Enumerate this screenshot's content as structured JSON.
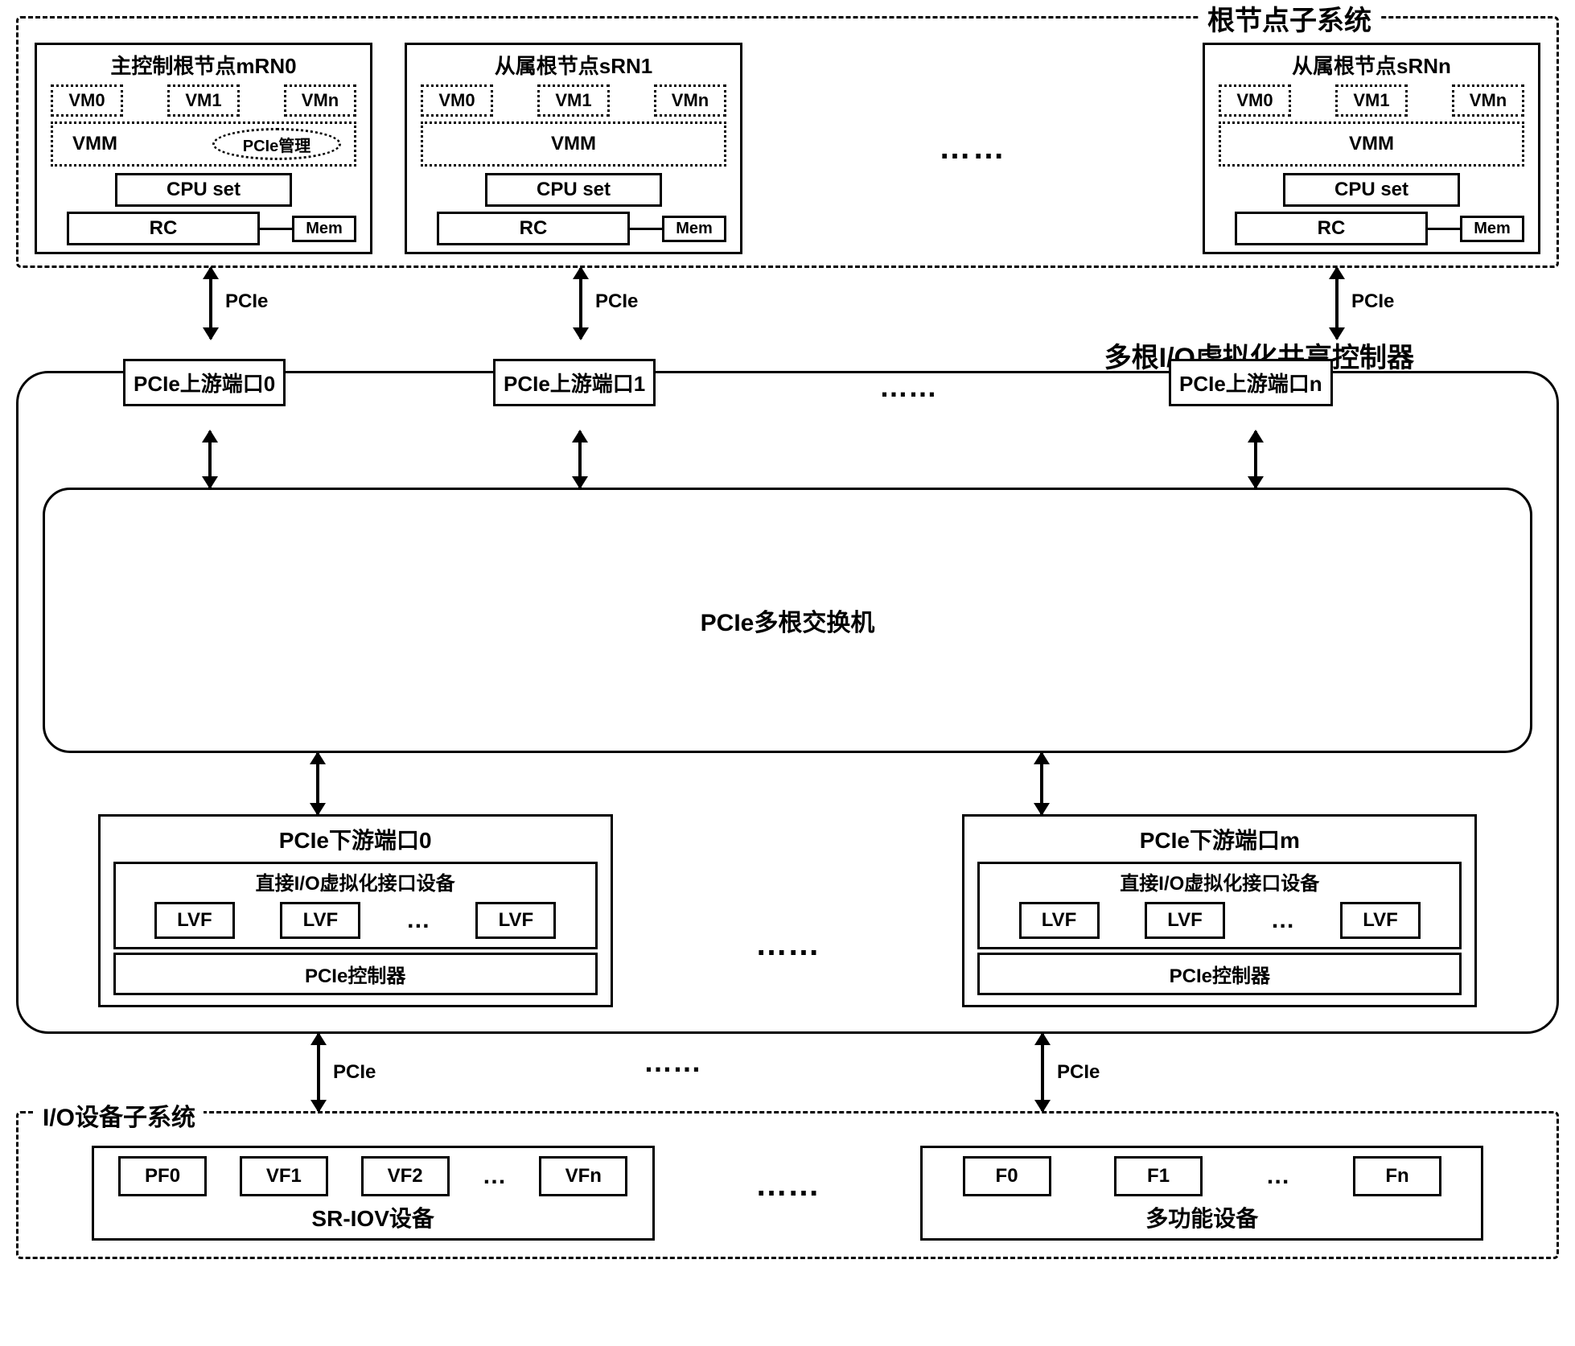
{
  "root_subsystem": {
    "title": "根节点子系统",
    "nodes": [
      {
        "title": "主控制根节点mRN0",
        "vms": [
          "VM0",
          "VM1",
          "VMn"
        ],
        "vmm": "VMM",
        "mgmt": "PCIe管理",
        "cpu": "CPU set",
        "rc": "RC",
        "mem": "Mem",
        "has_mgmt": true
      },
      {
        "title": "从属根节点sRN1",
        "vms": [
          "VM0",
          "VM1",
          "VMn"
        ],
        "vmm": "VMM",
        "cpu": "CPU set",
        "rc": "RC",
        "mem": "Mem",
        "has_mgmt": false
      },
      {
        "title": "从属根节点sRNn",
        "vms": [
          "VM0",
          "VM1",
          "VMn"
        ],
        "vmm": "VMM",
        "cpu": "CPU set",
        "rc": "RC",
        "mem": "Mem",
        "has_mgmt": false
      }
    ],
    "ellipsis": "……"
  },
  "connectors": {
    "pcie": "PCIe"
  },
  "controller": {
    "title": "多根I/O虚拟化共享控制器",
    "upstream_ports": [
      "PCIe上游端口0",
      "PCIe上游端口1",
      "PCIe上游端口n"
    ],
    "upstream_ellipsis": "……",
    "switch": "PCIe多根交换机",
    "downstream": [
      {
        "title": "PCIe下游端口0",
        "direct_io_title": "直接I/O虚拟化接口设备",
        "lvfs": [
          "LVF",
          "LVF",
          "LVF"
        ],
        "lvf_ellipsis": "…",
        "pcie_ctrl": "PCIe控制器"
      },
      {
        "title": "PCIe下游端口m",
        "direct_io_title": "直接I/O虚拟化接口设备",
        "lvfs": [
          "LVF",
          "LVF",
          "LVF"
        ],
        "lvf_ellipsis": "…",
        "pcie_ctrl": "PCIe控制器"
      }
    ],
    "downstream_ellipsis": "……"
  },
  "io_subsystem": {
    "title": "I/O设备子系统",
    "devices": [
      {
        "funcs": [
          "PF0",
          "VF1",
          "VF2",
          "VFn"
        ],
        "func_ellipsis": "…",
        "name": "SR-IOV设备"
      },
      {
        "funcs": [
          "F0",
          "F1",
          "Fn"
        ],
        "func_ellipsis": "…",
        "name": "多功能设备"
      }
    ],
    "ellipsis": "……"
  }
}
